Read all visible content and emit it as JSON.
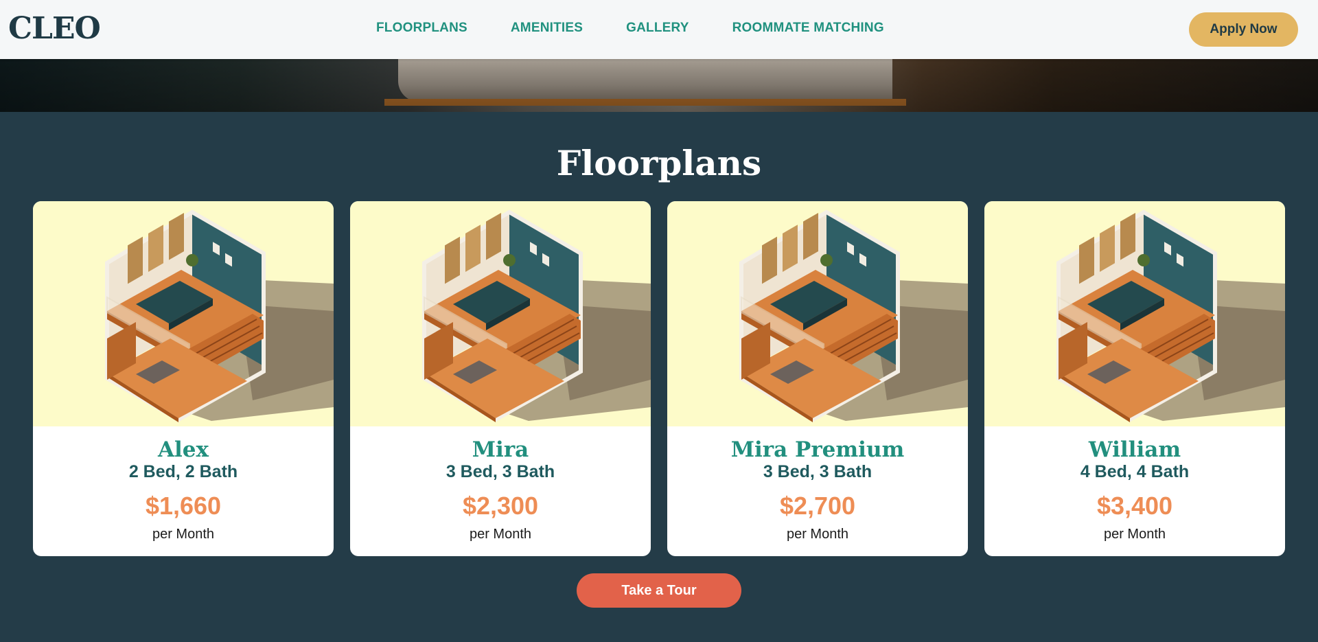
{
  "header": {
    "logo": "CLEO",
    "nav": [
      {
        "label": "FLOORPLANS"
      },
      {
        "label": "AMENITIES"
      },
      {
        "label": "GALLERY"
      },
      {
        "label": "ROOMMATE MATCHING"
      }
    ],
    "apply_label": "Apply Now"
  },
  "section": {
    "title": "Floorplans",
    "cards": [
      {
        "name": "Alex",
        "beds": "2 Bed, 2 Bath",
        "price": "$1,660",
        "per": "per Month"
      },
      {
        "name": "Mira",
        "beds": "3 Bed, 3 Bath",
        "price": "$2,300",
        "per": "per Month"
      },
      {
        "name": "Mira Premium",
        "beds": "3 Bed, 3 Bath",
        "price": "$2,700",
        "per": "per Month"
      },
      {
        "name": "William",
        "beds": "4 Bed, 4 Bath",
        "price": "$3,400",
        "per": "per Month"
      }
    ],
    "tour_label": "Take a Tour"
  },
  "colors": {
    "background": "#243c48",
    "accent_teal": "#228f7e",
    "price_orange": "#ee8d55",
    "apply_gold": "#e3b662",
    "tour_red": "#e2624a",
    "card_image_bg": "#fdfbc9"
  }
}
